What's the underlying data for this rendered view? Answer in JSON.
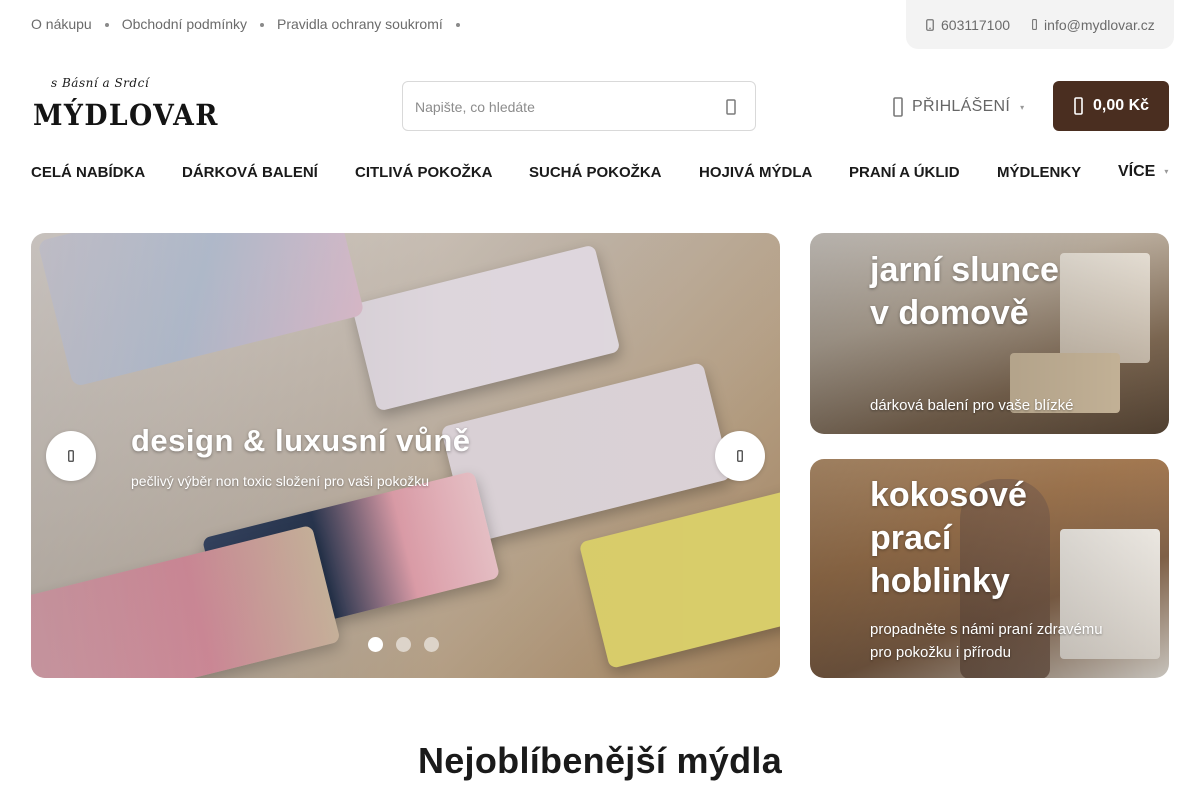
{
  "topbar": {
    "links": [
      "O nákupu",
      "Obchodní podmínky",
      "Pravidla ochrany soukromí"
    ],
    "phone": "603117100",
    "email": "info@mydlovar.cz"
  },
  "header": {
    "logo_tagline": "s Básní a Srdcí",
    "logo_text": "MÝDLOVAR",
    "search_placeholder": "Napište, co hledáte",
    "login_label": "PŘIHLÁŠENÍ",
    "cart_amount": "0,00 Kč"
  },
  "nav": {
    "items": [
      "CELÁ NABÍDKA",
      "DÁRKOVÁ BALENÍ",
      "CITLIVÁ POKOŽKA",
      "SUCHÁ POKOŽKA",
      "HOJIVÁ MÝDLA",
      "PRANÍ A ÚKLID",
      "MÝDLENKY"
    ],
    "more_label": "VÍCE"
  },
  "slider": {
    "title": "design & luxusní vůně",
    "subtitle": "pečlivý výběr non toxic složení pro vaši pokožku",
    "slide_count": 3,
    "active_slide": 1
  },
  "promos": [
    {
      "title": "jarní slunce v domově",
      "subtitle": "dárková balení pro vaše blízké"
    },
    {
      "title": "kokosové prací hoblinky",
      "subtitle": "propadněte s námi praní zdravému pro pokožku i přírodu"
    }
  ],
  "section": {
    "title": "Nejoblíbenější mýdla"
  },
  "colors": {
    "accent": "#4a2e20",
    "contact_bg": "#f3f3f3",
    "text": "#1a1a1a",
    "muted": "#6b6b6b"
  }
}
